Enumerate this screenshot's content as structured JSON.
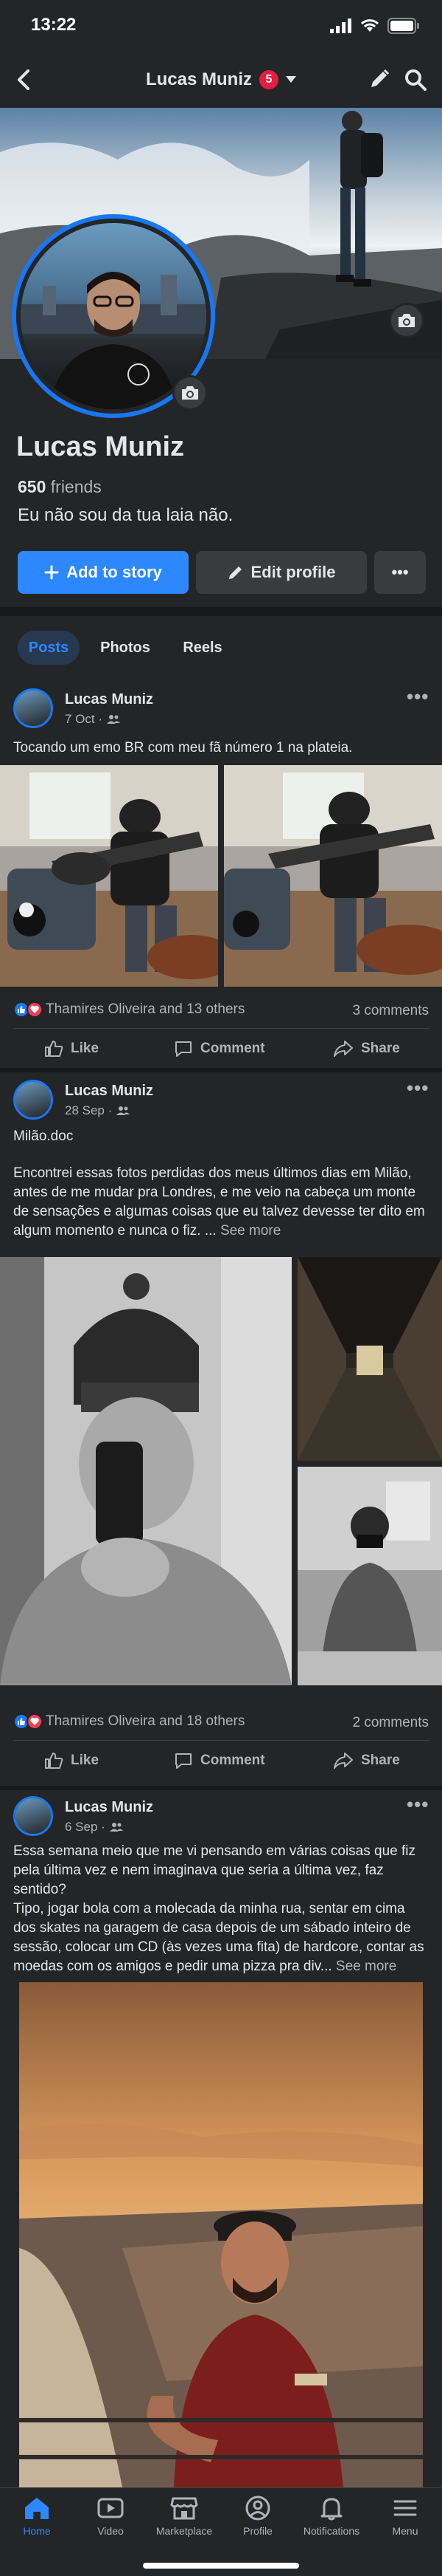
{
  "status_bar": {
    "time": "13:22"
  },
  "nav": {
    "title": "Lucas Muniz",
    "notification_count": "5"
  },
  "profile": {
    "name": "Lucas Muniz",
    "friends_count": "650",
    "friends_label": "friends",
    "bio": "Eu não sou da tua laia não.",
    "add_story_label": "Add to story",
    "edit_profile_label": "Edit profile",
    "more_label": "•••"
  },
  "tabs": [
    {
      "label": "Posts",
      "active": true
    },
    {
      "label": "Photos",
      "active": false
    },
    {
      "label": "Reels",
      "active": false
    }
  ],
  "posts": [
    {
      "author": "Lucas Muniz",
      "date": "7 Oct ·",
      "text": "Tocando um emo BR com meu fã número 1 na plateia.",
      "reactions_text": "Thamires Oliveira and 13 others",
      "comments": "3 comments"
    },
    {
      "author": "Lucas Muniz",
      "date": "28 Sep ·",
      "text_title": "Milão.doc",
      "text": "Encontrei essas fotos perdidas dos meus últimos dias em Milão, antes de me mudar pra Londres, e me veio na cabeça um monte de sensações e algumas coisas que eu talvez devesse ter dito em algum momento e nunca o fiz.",
      "text_end": "...",
      "see_more": "See more",
      "reactions_text": "Thamires Oliveira and 18 others",
      "comments": "2 comments"
    },
    {
      "author": "Lucas Muniz",
      "date": "6 Sep ·",
      "text": "Essa semana meio que me vi pensando em várias coisas que fiz pela última vez e nem imaginava que seria a última vez, faz sentido?",
      "text2": "Tipo, jogar bola com a molecada da minha rua, sentar em cima dos skates na garagem de casa depois de um sábado inteiro de sessão, colocar um CD (às vezes uma fita) de hardcore, contar as moedas com os amigos e pedir uma pizza pra div...",
      "see_more": "See more"
    }
  ],
  "actions": {
    "like": "Like",
    "comment": "Comment",
    "share": "Share"
  },
  "tabbar": [
    {
      "label": "Home",
      "icon": "home-icon",
      "active": true
    },
    {
      "label": "Video",
      "icon": "video-icon",
      "active": false
    },
    {
      "label": "Marketplace",
      "icon": "marketplace-icon",
      "active": false
    },
    {
      "label": "Profile",
      "icon": "profile-icon",
      "active": false
    },
    {
      "label": "Notifications",
      "icon": "bell-icon",
      "active": false
    },
    {
      "label": "Menu",
      "icon": "menu-icon",
      "active": false
    }
  ],
  "colors": {
    "accent": "#2d88ff",
    "background": "#18191a",
    "surface": "#242526",
    "badge": "#e41e3f"
  }
}
